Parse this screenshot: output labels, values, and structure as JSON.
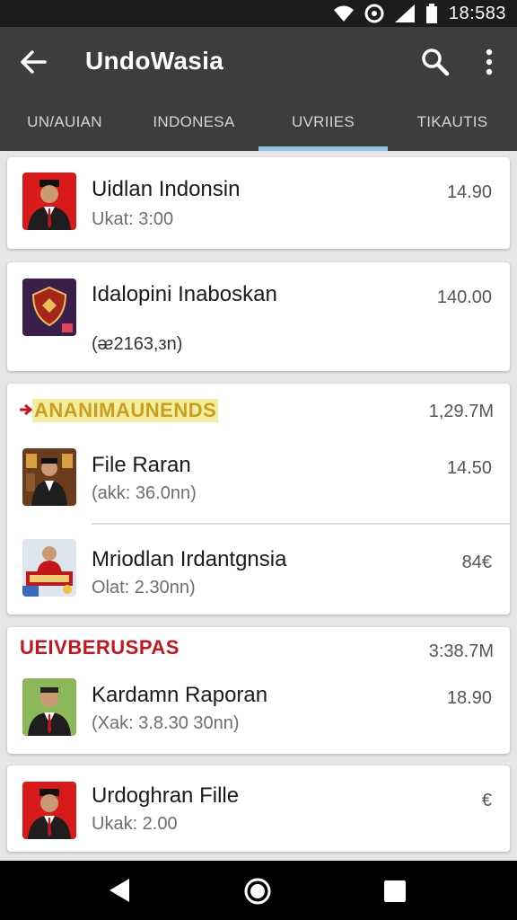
{
  "status_bar": {
    "time": "18:583"
  },
  "app_bar": {
    "title": "UndoWasia"
  },
  "tabs": [
    {
      "label": "UN/AUIAN"
    },
    {
      "label": "INDONESA"
    },
    {
      "label": "UVRIIES"
    },
    {
      "label": "TIKAUTIS"
    }
  ],
  "cards": {
    "c1": {
      "title": "Uidlan Indonsin",
      "subtitle": "Ukat: 3:00",
      "price": "14.90"
    },
    "c2": {
      "title": "Idalopini Inaboskan",
      "subtitle": "(ᴂ2163,ᴈn)",
      "price": "140.00"
    },
    "c3": {
      "section": "ANANIMAUNENDS",
      "total": "1,29.7M",
      "section_color": "#c8a020",
      "rows": [
        {
          "title": "File Raran",
          "subtitle": "(akk: 36.0nn)",
          "price": "14.50"
        },
        {
          "title": "Mriodlan Irdantgnsia",
          "subtitle": "Olat: 2.30nn)",
          "price": "84€"
        }
      ]
    },
    "c4": {
      "section": "UEIVBERUSPAS",
      "total": "3:38.7M",
      "section_color": "#c4161c",
      "row": {
        "title": "Kardamn Raporan",
        "subtitle": "(Xak: 3.8.30 30nn)",
        "price": "18.90"
      }
    },
    "c5": {
      "title": "Urdoghran Fille",
      "subtitle": "Ukak: 2.00",
      "price": "€"
    }
  },
  "colors": {
    "app_bar": "#3d3d3d",
    "tab_indicator": "#8fc6e6",
    "status_bar": "#1c1c1c"
  },
  "icons": [
    "wifi-icon",
    "sync-icon",
    "signal-icon",
    "battery-icon",
    "back-arrow-icon",
    "search-icon",
    "more-vert-icon",
    "nav-back-icon",
    "nav-home-icon",
    "nav-recent-icon"
  ]
}
